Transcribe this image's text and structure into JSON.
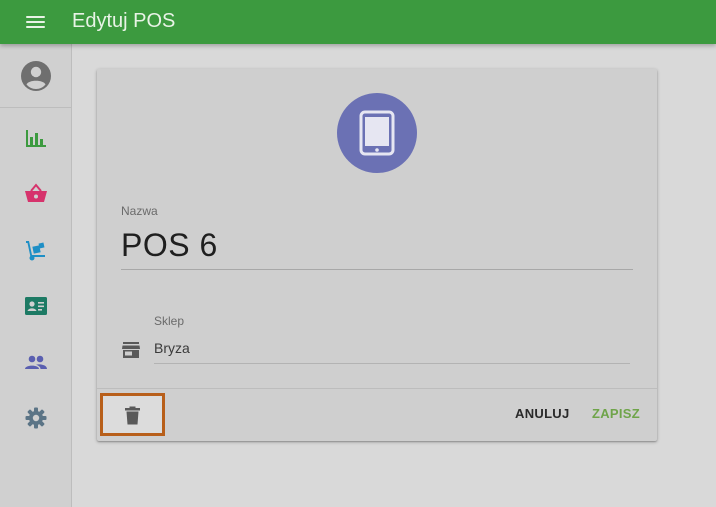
{
  "appbar": {
    "title": "Edytuj POS"
  },
  "sidebar": {
    "items": [
      {
        "name": "stats",
        "icon": "bar-chart-icon",
        "color": "#3c9a3f"
      },
      {
        "name": "basket",
        "icon": "shopping-basket-icon",
        "color": "#d6336c"
      },
      {
        "name": "delivery",
        "icon": "hand-truck-icon",
        "color": "#1e8fc6"
      },
      {
        "name": "contacts",
        "icon": "id-card-icon",
        "color": "#1d7a64"
      },
      {
        "name": "people",
        "icon": "people-icon",
        "color": "#5a5fb0"
      },
      {
        "name": "settings",
        "icon": "gear-icon",
        "color": "#5b7486"
      }
    ]
  },
  "form": {
    "device_icon": "tablet-icon",
    "device_color": "#6b71b4",
    "name_label": "Nazwa",
    "name_value": "POS 6",
    "store_label": "Sklep",
    "store_value": "Bryza",
    "store_icon": "store-icon"
  },
  "actions": {
    "delete_icon": "trash-icon",
    "cancel_label": "ANULUJ",
    "save_label": "ZAPISZ",
    "save_color": "#6fa44a",
    "highlight_color": "#b85f1a"
  }
}
